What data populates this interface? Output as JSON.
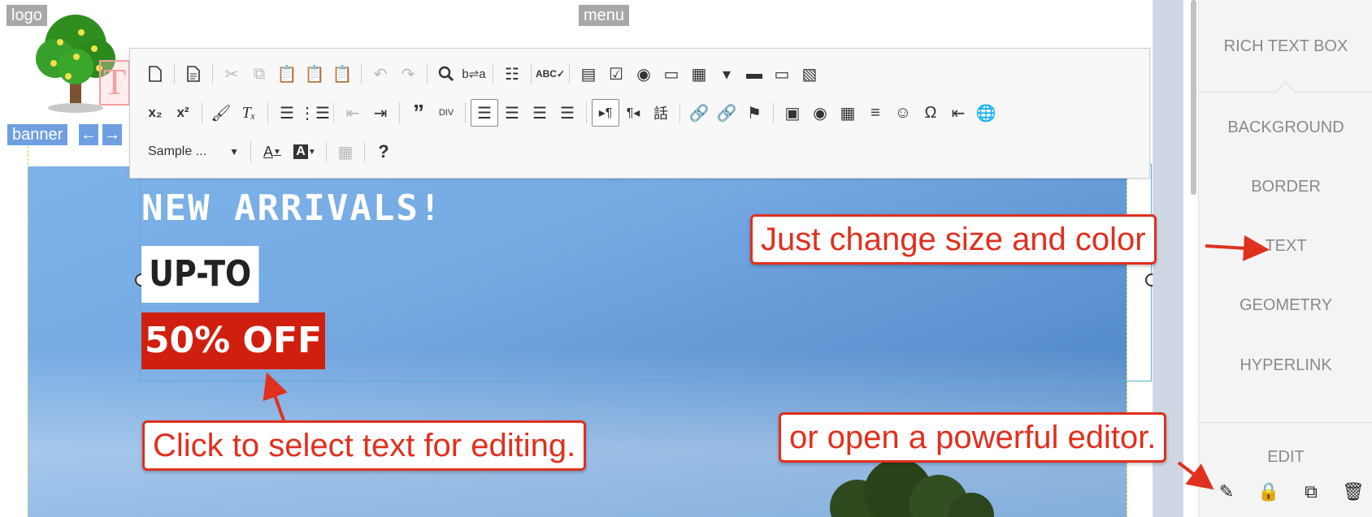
{
  "labels": {
    "logo": "logo",
    "menu": "menu",
    "banner": "banner"
  },
  "banner": {
    "headline": "NEW ARRIVALS!",
    "upto": "UP-TO",
    "off": "50% OFF",
    "off_color": "#d11f0f"
  },
  "toolbar": {
    "row1": [
      "new-page-icon",
      "templates-icon",
      "cut-icon",
      "copy-icon",
      "paste-icon",
      "paste-text-icon",
      "paste-word-icon",
      "undo-icon",
      "redo-icon",
      "find-icon",
      "replace-icon",
      "select-all-icon",
      "spellcheck-icon",
      "form-icon",
      "checkbox-icon",
      "radio-icon",
      "text-field-icon",
      "textarea-icon",
      "select-icon",
      "button-icon",
      "image-button-icon",
      "hidden-field-icon"
    ],
    "row2": [
      "subscript-icon",
      "superscript-icon",
      "copy-format-icon",
      "remove-format-icon",
      "numbered-list-icon",
      "bulleted-list-icon",
      "decrease-indent-icon",
      "increase-indent-icon",
      "blockquote-icon",
      "div-icon",
      "align-left-icon",
      "align-center-icon",
      "align-right-icon",
      "justify-icon",
      "ltr-icon",
      "rtl-icon",
      "language-icon",
      "link-icon",
      "unlink-icon",
      "anchor-icon",
      "image-icon",
      "flash-icon",
      "table-icon",
      "horizontal-line-icon",
      "smiley-icon",
      "special-char-icon",
      "page-break-icon",
      "iframe-icon"
    ],
    "format_combo": "Sample ...",
    "row3": [
      "text-color-icon",
      "bg-color-icon",
      "show-blocks-icon",
      "help-icon"
    ]
  },
  "panel": {
    "title": "RICH TEXT BOX",
    "items": [
      "BACKGROUND",
      "BORDER",
      "TEXT",
      "GEOMETRY",
      "HYPERLINK"
    ],
    "edit": "EDIT",
    "footer_icons": [
      "pencil-icon",
      "lock-icon",
      "duplicate-icon",
      "trash-icon"
    ]
  },
  "callouts": {
    "size_color": "Just change size and color",
    "select_text": "Click to select text for editing.",
    "editor": "or open a powerful editor."
  },
  "colors": {
    "callout": "#e0301e",
    "selection": "#57b0d6",
    "guide": "#b6d83b",
    "tag": "#a8a8a8",
    "banner_tag": "#6f9fe0"
  }
}
